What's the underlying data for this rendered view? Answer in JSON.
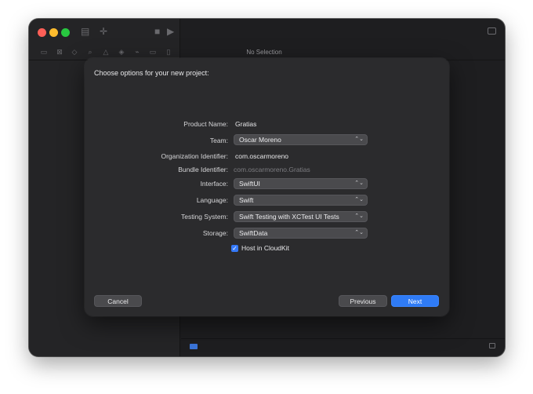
{
  "workspace": {
    "no_selection": "No Selection"
  },
  "dialog": {
    "title": "Choose options for your new project:",
    "fields": {
      "product_name": {
        "label": "Product Name:",
        "value": "Gratias"
      },
      "team": {
        "label": "Team:",
        "value": "Oscar Moreno"
      },
      "organization_identifier": {
        "label": "Organization Identifier:",
        "value": "com.oscarmoreno"
      },
      "bundle_identifier": {
        "label": "Bundle Identifier:",
        "value": "com.oscarmoreno.Gratias"
      },
      "interface": {
        "label": "Interface:",
        "value": "SwiftUI"
      },
      "language": {
        "label": "Language:",
        "value": "Swift"
      },
      "testing_system": {
        "label": "Testing System:",
        "value": "Swift Testing with XCTest UI Tests"
      },
      "storage": {
        "label": "Storage:",
        "value": "SwiftData"
      }
    },
    "host_in_cloudkit": {
      "label": "Host in CloudKit",
      "checked": true
    },
    "buttons": {
      "cancel": "Cancel",
      "previous": "Previous",
      "next": "Next"
    }
  },
  "colors": {
    "accent": "#2f7bf5",
    "window_bg": "#1e1e20",
    "sheet_bg": "#2b2b2d"
  }
}
